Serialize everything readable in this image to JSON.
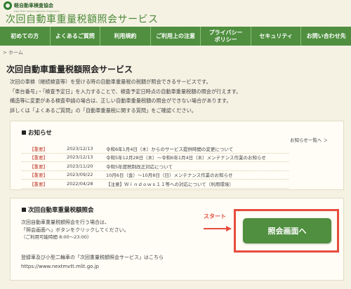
{
  "header": {
    "logo_text": "軽自動車検査協会",
    "logo_sub": "Light Motor Vehicle Inspection Organization",
    "site_title": "次回自動車重量税額照会サービス"
  },
  "nav": [
    {
      "label": "初めての方"
    },
    {
      "label": "よくあるご質問"
    },
    {
      "label": "利用規約"
    },
    {
      "label": "ご利用上の注意"
    },
    {
      "label": "プライバシー\nポリシー"
    },
    {
      "label": "セキュリティ"
    },
    {
      "label": "お問い合わせ先"
    }
  ],
  "breadcrumb": "> ホーム",
  "page_title": "次回自動車重量税額照会サービス",
  "intro": [
    "次回の車検（継続検査等）を受ける時の自動車重量税の税額が照会できるサービスです。",
    "「車台番号」・「検査予定日」を入力することで、検査予定日時点の自動車重量税額の照会が行えます。",
    "構造等に変更がある検査申請の場合は、正しい自動車重量税額の照会ができない場合があります。",
    "詳しくは「よくあるご質問」の「自動車重量税に関する質問」をご確認ください。"
  ],
  "news": {
    "heading": "お知らせ",
    "more": "お知らせ一覧へ ＞",
    "items": [
      {
        "tag": "【重要】",
        "date": "2023/12/13",
        "text": "令和6年1月4日（木）からのサービス提供時間の変更について"
      },
      {
        "tag": "【重要】",
        "date": "2023/12/13",
        "text": "令和5年12月28日（木）～令和6年1月4日（木）メンテナンス作業のお知らせ"
      },
      {
        "tag": "【重要】",
        "date": "2023/11/20",
        "text": "令和5年度税制改正対応について"
      },
      {
        "tag": "【重要】",
        "date": "2023/09/22",
        "text": "10月6日（金）～10月8日（日）メンテナンス作業のお知らせ"
      },
      {
        "tag": "【重要】",
        "date": "2022/04/28",
        "text": "【注意】Ｗｉｎｄｏｗｓ１１等への対応について（利用環境）"
      }
    ]
  },
  "app": {
    "heading": "次回自動車重量税額照会",
    "line1": "次回自動車重量税額照会を行う場合は、",
    "line2": "「照会画面へ」ボタンをクリックしてください。",
    "hours": "（ご利用可能時間 8:00～23:00）",
    "note1": "登録車及び小型二輪車の「次回重量税額照会サービス」はこちら",
    "note2": "https://www.nextmvtt.mlit.go.jp",
    "start_label": "スタート",
    "button_label": "照会画面へ"
  },
  "colors": {
    "nav_green": "#4f8f3f",
    "title_green": "#4d8a3a",
    "important_red": "#c0392b",
    "highlight_red": "#e74c3c"
  }
}
